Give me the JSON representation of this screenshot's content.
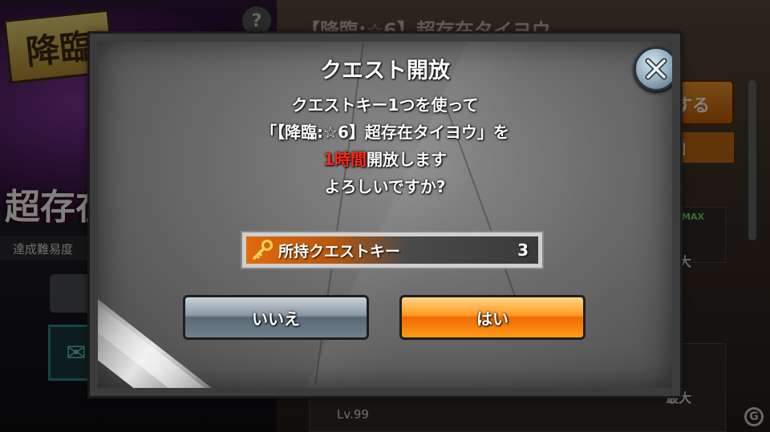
{
  "background": {
    "help_label": "?",
    "quest_title": "【降臨:☆6】超存在タイヨウ",
    "badge_text": "降臨",
    "big_title": "超存在",
    "difficulty_label": "達成難易度",
    "side_button_label": "する",
    "side_tag_label": "回",
    "max_badge": "MAX",
    "stat_label_1": "最大",
    "stat_label_2": "最大",
    "level_label": "Lv.99"
  },
  "dialog": {
    "title": "クエスト開放",
    "message": {
      "line1": "クエストキー1つを使って",
      "line2": "「【降臨:☆6】超存在タイヨウ」を",
      "line3_highlight": "1時間",
      "line3_rest": "開放します",
      "line4": "よろしいですか?"
    },
    "key_bar": {
      "label": "所持クエストキー",
      "count": "3"
    },
    "buttons": {
      "no_label": "いいえ",
      "yes_label": "はい"
    }
  },
  "colors": {
    "highlight_red": "#ff2a1a",
    "yes_orange": "#f06a00",
    "no_steel": "#71818c"
  }
}
